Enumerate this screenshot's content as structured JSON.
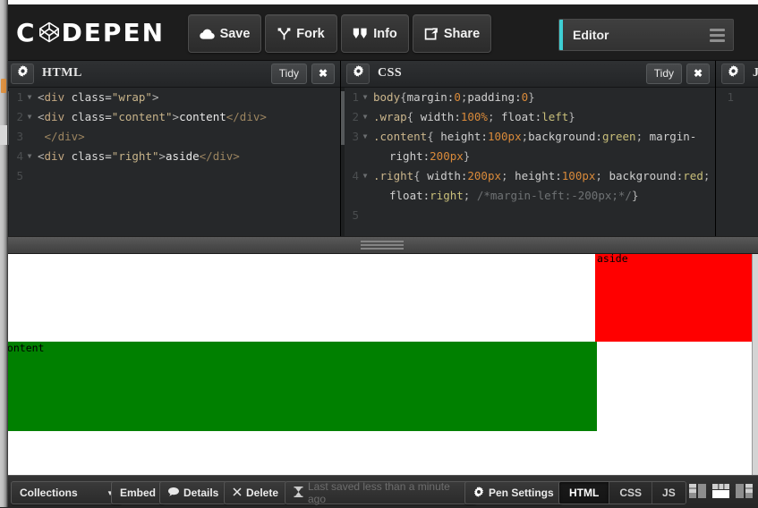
{
  "app": {
    "name": "CodePen",
    "logo_text_left": "C",
    "logo_text_right": "DEPEN"
  },
  "header": {
    "buttons": [
      {
        "label": "Save",
        "icon": "cloud-icon"
      },
      {
        "label": "Fork",
        "icon": "fork-icon"
      },
      {
        "label": "Info",
        "icon": "info-icon"
      },
      {
        "label": "Share",
        "icon": "share-icon"
      }
    ],
    "editor_select": {
      "label": "Editor",
      "accent_color": "#3ecfd4",
      "menu_icon": "hamburger-icon"
    }
  },
  "panes": {
    "html": {
      "title": "HTML",
      "gear_icon": "gear-icon",
      "tidy_label": "Tidy",
      "close_label": "✖",
      "lines": [
        {
          "num": "1",
          "fold": true,
          "indent": false,
          "tokens": [
            {
              "t": "punc",
              "s": "<"
            },
            {
              "t": "tag",
              "s": "div"
            },
            {
              "t": "attr",
              "s": " class="
            },
            {
              "t": "str",
              "s": "\"wrap\""
            },
            {
              "t": "punc",
              "s": ">"
            }
          ]
        },
        {
          "num": "2",
          "fold": true,
          "indent": false,
          "tokens": [
            {
              "t": "punc",
              "s": "<"
            },
            {
              "t": "tag",
              "s": "div"
            },
            {
              "t": "attr",
              "s": " class="
            },
            {
              "t": "str",
              "s": "\"content\""
            },
            {
              "t": "punc",
              "s": ">"
            },
            {
              "t": "txt",
              "s": "content"
            },
            {
              "t": "close",
              "s": "</div>"
            }
          ]
        },
        {
          "num": "3",
          "fold": false,
          "indent": false,
          "tokens": [
            {
              "t": "close",
              "s": " </div>"
            }
          ]
        },
        {
          "num": "4",
          "fold": true,
          "indent": false,
          "tokens": [
            {
              "t": "punc",
              "s": "<"
            },
            {
              "t": "tag",
              "s": "div"
            },
            {
              "t": "attr",
              "s": " class="
            },
            {
              "t": "str",
              "s": "\"right\""
            },
            {
              "t": "punc",
              "s": ">"
            },
            {
              "t": "txt",
              "s": "aside"
            },
            {
              "t": "close",
              "s": "</div>"
            }
          ]
        },
        {
          "num": "5",
          "fold": false,
          "indent": false,
          "tokens": []
        }
      ]
    },
    "css": {
      "title": "CSS",
      "gear_icon": "gear-icon",
      "tidy_label": "Tidy",
      "close_label": "✖",
      "lines": [
        {
          "num": "1",
          "fold": true,
          "indent": false,
          "tokens": [
            {
              "t": "sel",
              "s": "body"
            },
            {
              "t": "punc",
              "s": "{"
            },
            {
              "t": "prop",
              "s": "margin:"
            },
            {
              "t": "val",
              "s": "0"
            },
            {
              "t": "punc",
              "s": ";"
            },
            {
              "t": "prop",
              "s": "padding:"
            },
            {
              "t": "val",
              "s": "0"
            },
            {
              "t": "punc",
              "s": "}"
            }
          ]
        },
        {
          "num": "2",
          "fold": true,
          "indent": false,
          "tokens": [
            {
              "t": "sel",
              "s": ".wrap"
            },
            {
              "t": "punc",
              "s": "{ "
            },
            {
              "t": "prop",
              "s": "width:"
            },
            {
              "t": "val",
              "s": "100%"
            },
            {
              "t": "punc",
              "s": "; "
            },
            {
              "t": "prop",
              "s": "float:"
            },
            {
              "t": "kw",
              "s": "left"
            },
            {
              "t": "punc",
              "s": "}"
            }
          ]
        },
        {
          "num": "3",
          "fold": true,
          "indent": false,
          "tokens": [
            {
              "t": "sel",
              "s": ".content"
            },
            {
              "t": "punc",
              "s": "{ "
            },
            {
              "t": "prop",
              "s": "height:"
            },
            {
              "t": "val",
              "s": "100px"
            },
            {
              "t": "punc",
              "s": ";"
            },
            {
              "t": "prop",
              "s": "background:"
            },
            {
              "t": "kw",
              "s": "green"
            },
            {
              "t": "punc",
              "s": "; "
            },
            {
              "t": "prop",
              "s": "margin-"
            }
          ]
        },
        {
          "num": "",
          "fold": false,
          "indent": true,
          "tokens": [
            {
              "t": "prop",
              "s": "right:"
            },
            {
              "t": "val",
              "s": "200px"
            },
            {
              "t": "punc",
              "s": "}"
            }
          ]
        },
        {
          "num": "4",
          "fold": true,
          "indent": false,
          "tokens": [
            {
              "t": "sel",
              "s": ".right"
            },
            {
              "t": "punc",
              "s": "{ "
            },
            {
              "t": "prop",
              "s": "width:"
            },
            {
              "t": "val",
              "s": "200px"
            },
            {
              "t": "punc",
              "s": "; "
            },
            {
              "t": "prop",
              "s": "height:"
            },
            {
              "t": "val",
              "s": "100px"
            },
            {
              "t": "punc",
              "s": "; "
            },
            {
              "t": "prop",
              "s": "background:"
            },
            {
              "t": "kw",
              "s": "red"
            },
            {
              "t": "punc",
              "s": ";"
            }
          ]
        },
        {
          "num": "",
          "fold": false,
          "indent": true,
          "tokens": [
            {
              "t": "prop",
              "s": "float:"
            },
            {
              "t": "kw",
              "s": "right"
            },
            {
              "t": "punc",
              "s": "; "
            },
            {
              "t": "com",
              "s": "/*margin-left:-200px;*/"
            },
            {
              "t": "punc",
              "s": "}"
            }
          ]
        },
        {
          "num": "5",
          "fold": false,
          "indent": false,
          "tokens": []
        }
      ]
    },
    "js": {
      "title": "JS",
      "gear_icon": "gear-icon",
      "lines": [
        {
          "num": "1",
          "fold": false,
          "indent": false,
          "tokens": []
        }
      ]
    }
  },
  "preview": {
    "content_text": "content",
    "aside_text": "aside",
    "content_color": "#008000",
    "aside_color": "#ff0000",
    "background": "#ffffff"
  },
  "bottom_bar": {
    "collections_label": "Collections",
    "collections_caret": "▼",
    "embed_label": "Embed",
    "details_label": "Details",
    "details_icon": "comment-icon",
    "delete_label": "Delete",
    "delete_icon": "close-icon",
    "saved_status": "Last saved less than a minute ago",
    "saved_icon": "hourglass-icon",
    "pen_settings_label": "Pen Settings",
    "pen_settings_icon": "gear-icon",
    "segments": [
      {
        "label": "HTML",
        "active": true
      },
      {
        "label": "CSS",
        "active": false
      },
      {
        "label": "JS",
        "active": false
      }
    ],
    "layout_icons": [
      {
        "name": "layout-left-icon",
        "active": false
      },
      {
        "name": "layout-top-icon",
        "active": true
      },
      {
        "name": "layout-right-icon",
        "active": false
      }
    ]
  }
}
